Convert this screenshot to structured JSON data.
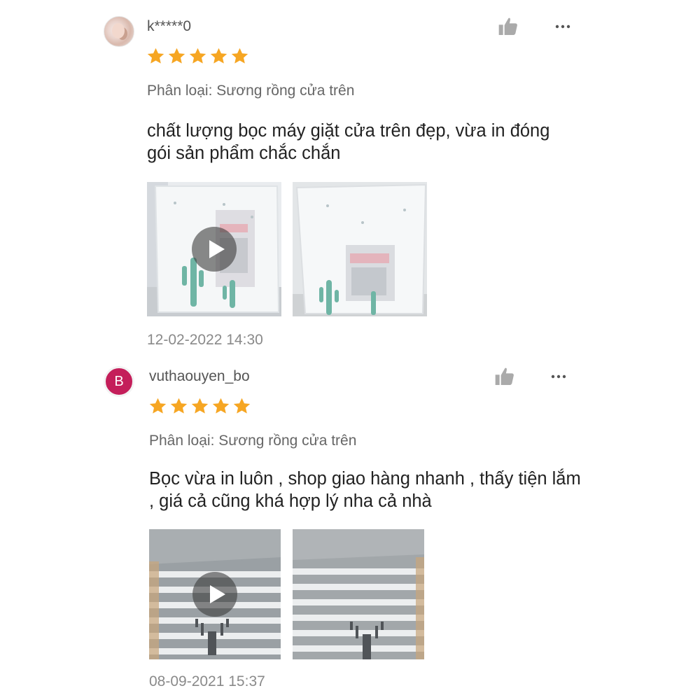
{
  "reviews": [
    {
      "username": "k*****0",
      "avatar": {
        "type": "photo",
        "icon": "user-photo-avatar"
      },
      "rating": 5,
      "variant": "Phân loại: Sương rồng cửa trên",
      "content": "chất lượng bọc máy giặt cửa trên đẹp, vừa in đóng gói sản phẩm chắc chắn",
      "media": [
        {
          "kind": "video",
          "icon": "play-icon",
          "pattern": "cactus"
        },
        {
          "kind": "image",
          "pattern": "cactus"
        }
      ],
      "timestamp": "12-02-2022 14:30"
    },
    {
      "username": "vuthaouyen_bo",
      "avatar": {
        "type": "letter",
        "letter": "B",
        "color": "#c41e5a"
      },
      "rating": 5,
      "variant": "Phân loại: Sương rồng cửa trên",
      "content": "Bọc vừa in luôn , shop giao hàng nhanh , thấy tiện lắm , giá cả cũng khá hợp lý nha cả nhà",
      "media": [
        {
          "kind": "video",
          "icon": "play-icon",
          "pattern": "striped-deer"
        },
        {
          "kind": "image",
          "pattern": "striped-deer"
        }
      ],
      "timestamp": "08-09-2021 15:37"
    }
  ],
  "colors": {
    "star": "#f6a623",
    "like_icon": "#aaaaaa",
    "more_icon": "#555555",
    "text_primary": "#222222",
    "text_secondary": "#666666",
    "text_muted": "#8a8a8a"
  }
}
